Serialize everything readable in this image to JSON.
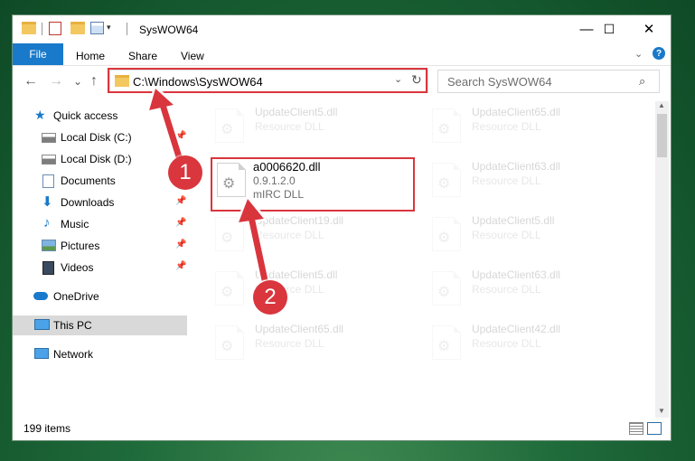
{
  "window": {
    "title": "SysWOW64"
  },
  "window_controls": {
    "minimize": "—",
    "maximize": "☐",
    "close": "✕"
  },
  "ribbon": {
    "tabs": [
      "File",
      "Home",
      "Share",
      "View"
    ],
    "collapse_icon": "chevron-down-icon",
    "help_icon": "?"
  },
  "navigation": {
    "back": "←",
    "forward": "→",
    "recent": "⌄",
    "up": "↑"
  },
  "address": {
    "path": "C:\\Windows\\SysWOW64",
    "dropdown": "⌄",
    "refresh": "↻"
  },
  "search": {
    "placeholder": "Search SysWOW64",
    "icon": "⌕"
  },
  "sidebar": {
    "items": [
      {
        "label": "Quick access",
        "icon": "star-icon",
        "pinned": false
      },
      {
        "label": "Local Disk (C:)",
        "icon": "drive-icon",
        "pinned": true
      },
      {
        "label": "Local Disk (D:)",
        "icon": "drive-icon",
        "pinned": false
      },
      {
        "label": "Documents",
        "icon": "documents-icon",
        "pinned": true
      },
      {
        "label": "Downloads",
        "icon": "download-arrow-icon",
        "pinned": true
      },
      {
        "label": "Music",
        "icon": "music-note-icon",
        "pinned": true
      },
      {
        "label": "Pictures",
        "icon": "pictures-icon",
        "pinned": true
      },
      {
        "label": "Videos",
        "icon": "film-icon",
        "pinned": true
      },
      {
        "label": "OneDrive",
        "icon": "cloud-icon",
        "pinned": false
      },
      {
        "label": "This PC",
        "icon": "monitor-icon",
        "pinned": false,
        "selected": true
      },
      {
        "label": "Network",
        "icon": "network-icon",
        "pinned": false
      }
    ],
    "pin_glyph": "📌"
  },
  "files": {
    "highlighted": {
      "name": "a0006620.dll",
      "version": "0.9.1.2.0",
      "description": "mIRC DLL"
    },
    "left_column": [
      {
        "name": "UpdateClient5.dll",
        "type": "Resource DLL"
      },
      {
        "name": "UpdateClient19.dll",
        "type": "Resource DLL"
      },
      {
        "name": "UpdateClient5.dll",
        "type": "Resource DLL"
      },
      {
        "name": "UpdateClient65.dll",
        "type": "Resource DLL"
      }
    ],
    "right_column": [
      {
        "name": "UpdateClient65.dll",
        "type": "Resource DLL"
      },
      {
        "name": "UpdateClient63.dll",
        "type": "Resource DLL"
      },
      {
        "name": "UpdateClient5.dll",
        "type": "Resource DLL"
      },
      {
        "name": "UpdateClient63.dll",
        "type": "Resource DLL"
      },
      {
        "name": "UpdateClient42.dll",
        "type": "Resource DLL"
      }
    ]
  },
  "status": {
    "item_count": "199 items"
  },
  "annotations": {
    "step1": "1",
    "step2": "2",
    "highlight_color": "#d9363e"
  }
}
